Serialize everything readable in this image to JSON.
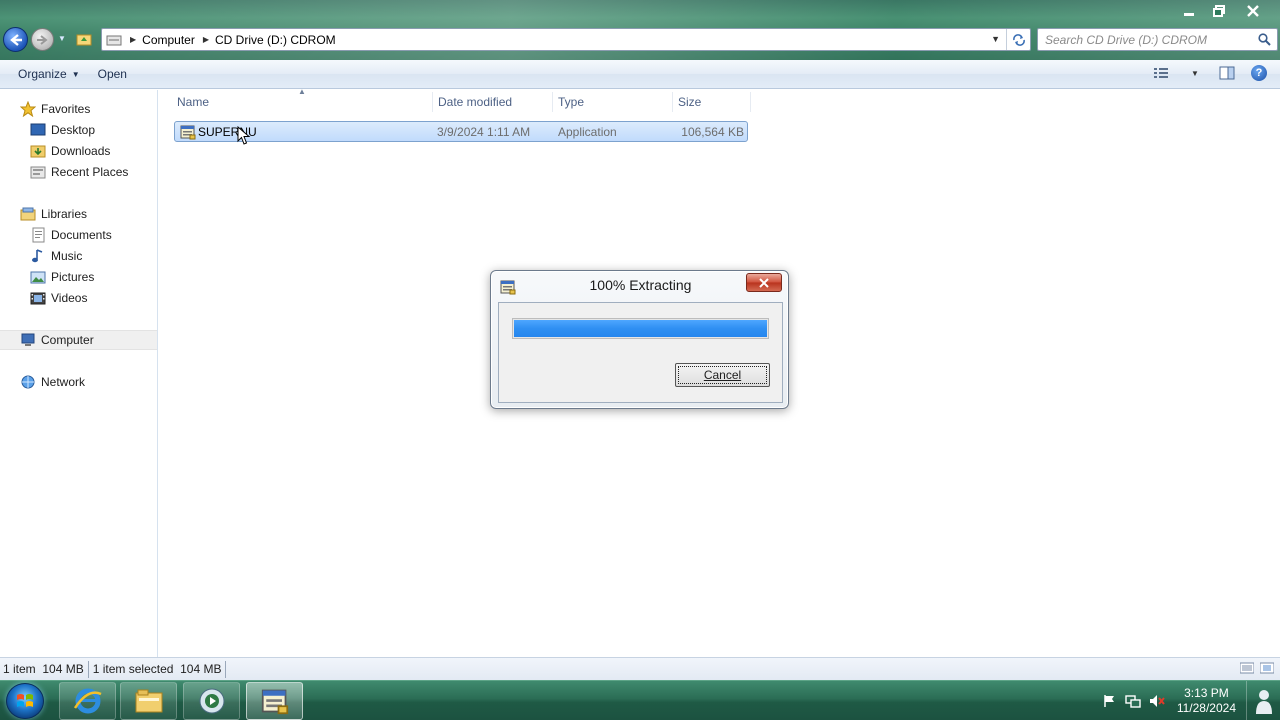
{
  "address": {
    "crumbs": [
      "Computer",
      "CD Drive (D:) CDROM"
    ],
    "search_placeholder": "Search CD Drive (D:) CDROM"
  },
  "toolbar": {
    "organize_label": "Organize",
    "open_label": "Open"
  },
  "sidebar": {
    "favorites": {
      "label": "Favorites",
      "items": [
        "Desktop",
        "Downloads",
        "Recent Places"
      ]
    },
    "libraries": {
      "label": "Libraries",
      "items": [
        "Documents",
        "Music",
        "Pictures",
        "Videos"
      ]
    },
    "computer_label": "Computer",
    "network_label": "Network"
  },
  "file_list": {
    "columns": [
      "Name",
      "Date modified",
      "Type",
      "Size"
    ],
    "rows": [
      {
        "name": "SUPERNU",
        "date_modified": "3/9/2024 1:11 AM",
        "type": "Application",
        "size": "106,564 KB"
      }
    ]
  },
  "status": {
    "items_count": "1 item",
    "items_size": "104 MB",
    "selected_count": "1 item selected",
    "selected_size": "104 MB"
  },
  "dialog": {
    "title": "100% Extracting",
    "progress_percent": 100,
    "cancel_label": "Cancel"
  },
  "taskbar": {
    "time": "3:13 PM",
    "date": "11/28/2024"
  },
  "colors": {
    "selection": "#c1dbfc",
    "progress": "#2f8ff2",
    "taskbar": "#2b6d55"
  }
}
